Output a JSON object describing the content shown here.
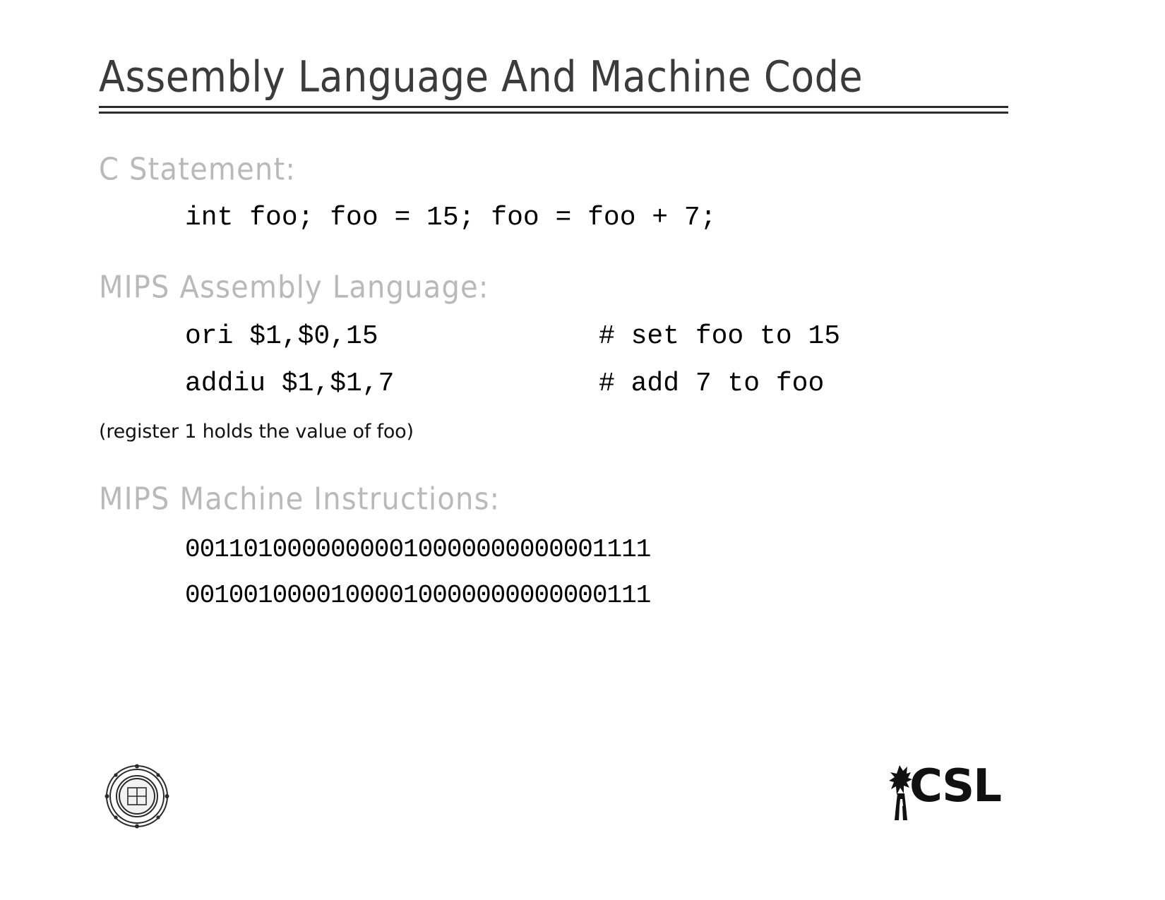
{
  "slide": {
    "title": "Assembly Language And Machine Code",
    "sections": {
      "c_statement": {
        "heading": "C Statement:",
        "code": "int foo; foo = 15; foo = foo + 7;"
      },
      "mips_assembly": {
        "heading": "MIPS Assembly Language:",
        "instructions": [
          {
            "code": "ori $1,$0,15",
            "comment": "# set foo to 15"
          },
          {
            "code": "addiu $1,$1,7",
            "comment": "# add 7 to foo"
          }
        ],
        "note": "(register 1 holds the value of foo)"
      },
      "mips_machine": {
        "heading": "MIPS Machine Instructions:",
        "bits": [
          "00110100000000010000000000001111",
          "00100100001000010000000000000111"
        ]
      }
    },
    "logos": {
      "seal_name": "university-seal",
      "csl_text": "CSL",
      "csl_name": "csl-logo"
    },
    "colors": {
      "background": "#ffffff",
      "title": "#3b3b3b",
      "heading": "#b9b9b9",
      "body": "#000000",
      "rule": "#2b2b2b"
    }
  }
}
